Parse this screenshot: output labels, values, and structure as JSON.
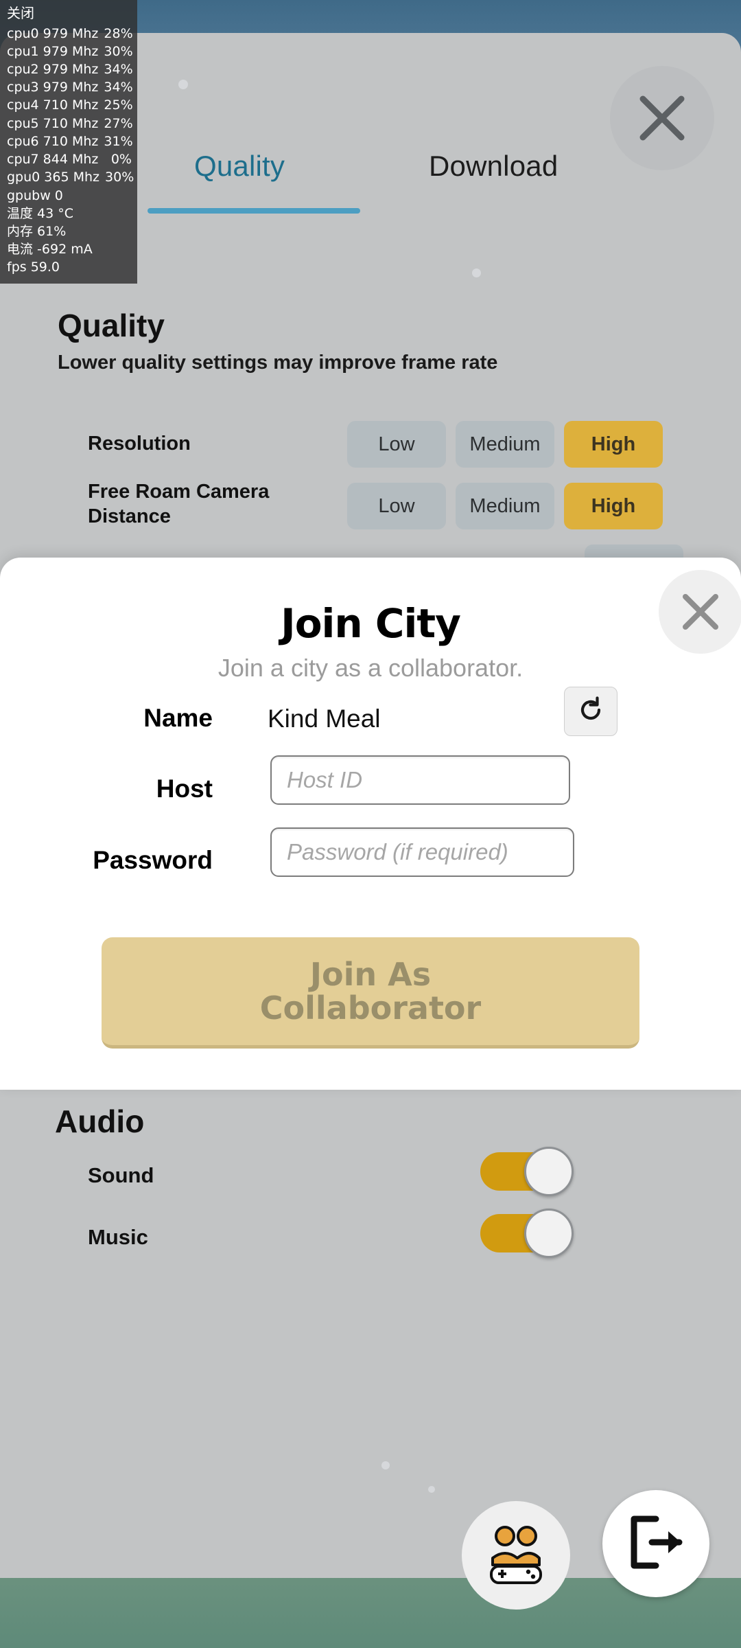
{
  "overlay": {
    "close_label": "关闭",
    "lines": [
      {
        "key": "cpu0 979 Mhz",
        "value": "28%"
      },
      {
        "key": "cpu1 979 Mhz",
        "value": "30%"
      },
      {
        "key": "cpu2 979 Mhz",
        "value": "34%"
      },
      {
        "key": "cpu3 979 Mhz",
        "value": "34%"
      },
      {
        "key": "cpu4 710 Mhz",
        "value": "25%"
      },
      {
        "key": "cpu5 710 Mhz",
        "value": "27%"
      },
      {
        "key": "cpu6 710 Mhz",
        "value": "31%"
      },
      {
        "key": "cpu7 844 Mhz",
        "value": "0%"
      },
      {
        "key": "gpu0 365 Mhz",
        "value": "30%"
      },
      {
        "key": "gpubw 0",
        "value": ""
      },
      {
        "key": "温度 43 °C",
        "value": ""
      },
      {
        "key": "内存 61%",
        "value": ""
      },
      {
        "key": "电流 -692 mA",
        "value": ""
      },
      {
        "key": "fps 59.0",
        "value": ""
      }
    ]
  },
  "settings": {
    "tabs": [
      {
        "label": "Quality",
        "active": true
      },
      {
        "label": "Download",
        "active": false
      }
    ],
    "close_icon": "close-x-icon",
    "quality": {
      "heading": "Quality",
      "subheading": "Lower quality settings may improve frame rate",
      "rows": [
        {
          "label": "Resolution",
          "options": [
            "Low",
            "Medium",
            "High"
          ],
          "selected": "High"
        },
        {
          "label": "Free Roam Camera Distance",
          "options": [
            "Low",
            "Medium",
            "High"
          ],
          "selected": "High"
        }
      ]
    },
    "audio": {
      "heading": "Audio",
      "rows": [
        {
          "label": "Sound",
          "on": true
        },
        {
          "label": "Music",
          "on": true
        }
      ]
    }
  },
  "modal": {
    "title": "Join City",
    "subtitle": "Join a city as a collaborator.",
    "close_icon": "close-x-icon",
    "refresh_icon": "refresh-icon",
    "fields": {
      "name_label": "Name",
      "name_value": "Kind Meal",
      "host_label": "Host",
      "host_placeholder": "Host ID",
      "host_value": "",
      "password_label": "Password",
      "password_placeholder": "Password (if required)",
      "password_value": ""
    },
    "submit_line1": "Join As",
    "submit_line2": "Collaborator"
  },
  "bottom": {
    "players_icon": "two-players-icon",
    "exit_icon": "exit-door-icon"
  },
  "colors": {
    "accent_gold": "#ddb03c",
    "tab_active": "#1d6e8c",
    "toggle_on": "#d19b10",
    "sheet_bg": "#c2c4c5",
    "submit_bg": "#e3ce96"
  }
}
